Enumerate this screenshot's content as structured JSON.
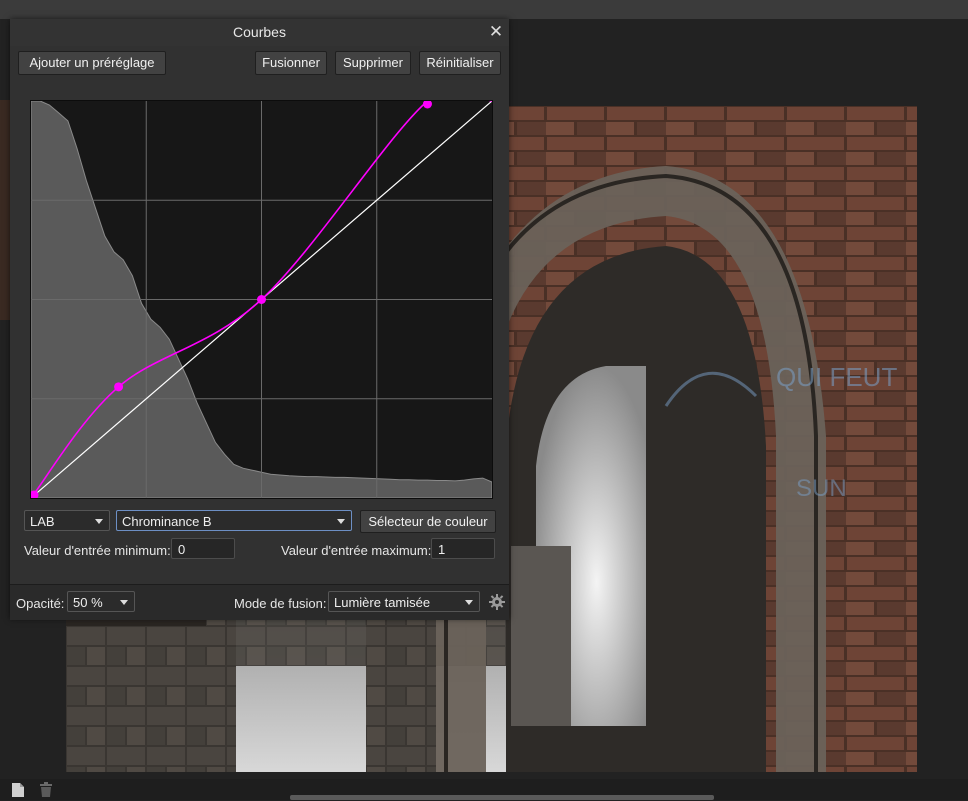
{
  "panel": {
    "title": "Courbes",
    "buttons": {
      "add_preset": "Ajouter un préréglage",
      "merge": "Fusionner",
      "delete": "Supprimer",
      "reset": "Réinitialiser"
    },
    "color_space": "LAB",
    "channel": "Chrominance B",
    "color_picker": "Sélecteur de couleur",
    "min_input_label": "Valeur d'entrée minimum:",
    "min_input_value": "0",
    "max_input_label": "Valeur d'entrée maximum:",
    "max_input_value": "1",
    "opacity_label": "Opacité:",
    "opacity_value": "50 %",
    "blend_mode_label": "Mode de fusion:",
    "blend_mode_value": "Lumière tamisée"
  },
  "curve": {
    "curve_color": "#ff00ff",
    "control_points": [
      [
        0.0,
        0.0
      ],
      [
        0.19,
        0.28
      ],
      [
        0.5,
        0.5
      ],
      [
        0.86,
        1.0
      ],
      [
        1.0,
        1.0
      ]
    ],
    "histogram": [
      1,
      1,
      0.99,
      0.97,
      0.95,
      0.88,
      0.8,
      0.73,
      0.66,
      0.62,
      0.6,
      0.56,
      0.49,
      0.45,
      0.43,
      0.4,
      0.35,
      0.3,
      0.24,
      0.19,
      0.14,
      0.11,
      0.085,
      0.075,
      0.07,
      0.065,
      0.06,
      0.058,
      0.056,
      0.055,
      0.054,
      0.054,
      0.053,
      0.052,
      0.052,
      0.051,
      0.05,
      0.049,
      0.048,
      0.047,
      0.046,
      0.046,
      0.045,
      0.045,
      0.044,
      0.044,
      0.043,
      0.045,
      0.048,
      0.05,
      0.04
    ]
  },
  "colors": {
    "panel_bg": "#313131",
    "graph_bg": "#171717",
    "curve": "#ff00ff"
  }
}
